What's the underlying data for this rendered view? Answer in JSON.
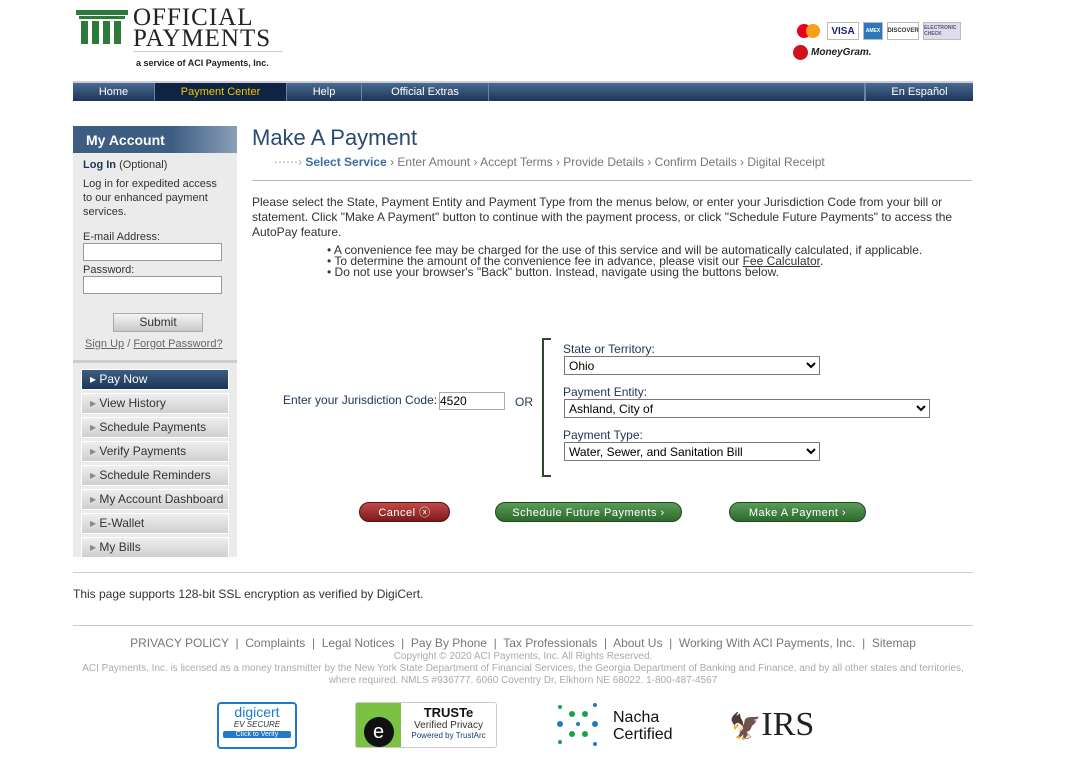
{
  "header": {
    "logo_line1": "OFFICIAL",
    "logo_line2": "PAYMENTS",
    "logo_tagline": "a service of ACI Payments, Inc.",
    "cards": [
      "mastercard",
      "VISA",
      "AMEX",
      "DISCOVER",
      "ELECTRONIC CHECK"
    ],
    "moneygram": "MoneyGram."
  },
  "nav": {
    "items": [
      "Home",
      "Payment Center",
      "Help",
      "Official Extras"
    ],
    "active": "Payment Center",
    "spanish": "En Español"
  },
  "sidebar": {
    "title": "My Account",
    "login": "Log In",
    "optional": "(Optional)",
    "desc": "Log in for expedited access to our enhanced payment services.",
    "email_label": "E-mail Address:",
    "password_label": "Password:",
    "submit": "Submit",
    "signup": "Sign Up",
    "forgot": "Forgot Password?",
    "menu": [
      "Pay Now",
      "View History",
      "Schedule Payments",
      "Verify Payments",
      "Schedule Reminders",
      "My Account Dashboard",
      "E-Wallet",
      "My Bills"
    ]
  },
  "main": {
    "title": "Make A Payment",
    "steps": [
      "Select Service",
      "Enter Amount",
      "Accept Terms",
      "Provide Details",
      "Confirm Details",
      "Digital Receipt"
    ],
    "intro": "Please select the State, Payment Entity and Payment Type from the menus below, or enter your Jurisdiction Code from your bill or statement. Click \"Make A Payment\" button to continue with the payment process, or click \"Schedule Future Payments\" to access the AutoPay feature.",
    "bullet1": "• A convenience fee may be charged for the use of this service and will be automatically calculated, if applicable.",
    "bullet2_pre": "• To determine the amount of the convenience fee in advance, please visit our ",
    "bullet2_link": "Fee Calculator",
    "bullet2_post": ".",
    "bullet3": "• Do not use your browser's \"Back\" button. Instead, navigate using the buttons below.",
    "jurisdiction_label": "Enter your Jurisdiction Code:",
    "jurisdiction_value": "4520",
    "or": "OR",
    "state_label": "State or Territory:",
    "state_value": "Ohio",
    "entity_label": "Payment Entity:",
    "entity_value": "Ashland, City of",
    "type_label": "Payment Type:",
    "type_value": "Water, Sewer, and Sanitation Bill",
    "cancel": "Cancel",
    "schedule": "Schedule Future Payments",
    "make": "Make A Payment",
    "ssl": "This page supports 128-bit SSL encryption as verified by DigiCert."
  },
  "footer": {
    "links": [
      "PRIVACY POLICY",
      "Complaints",
      "Legal Notices",
      "Pay By Phone",
      "Tax Professionals",
      "About Us",
      "Working With ACI Payments, Inc.",
      "Sitemap"
    ],
    "copyright": "Copyright © 2020 ACI Payments, Inc. All Rights Reserved.",
    "license": "ACI Payments, Inc. is licensed as a money transmitter by the New York State Department of Financial Services, the Georgia Department of Banking and Finance, and by all other states and territories, where required. NMLS #936777. 6060 Coventry Dr, Elkhorn NE 68022. 1-800-487-4567",
    "badges": {
      "digicert": "digicert",
      "digicert_ev": "EV SECURE",
      "digicert_verify": "Click to Verify",
      "truste": "TRUSTe",
      "truste_sub": "Verified Privacy",
      "truste_by": "Powered by TrustArc",
      "nacha1": "Nacha",
      "nacha2": "Certified",
      "irs": "IRS"
    }
  }
}
